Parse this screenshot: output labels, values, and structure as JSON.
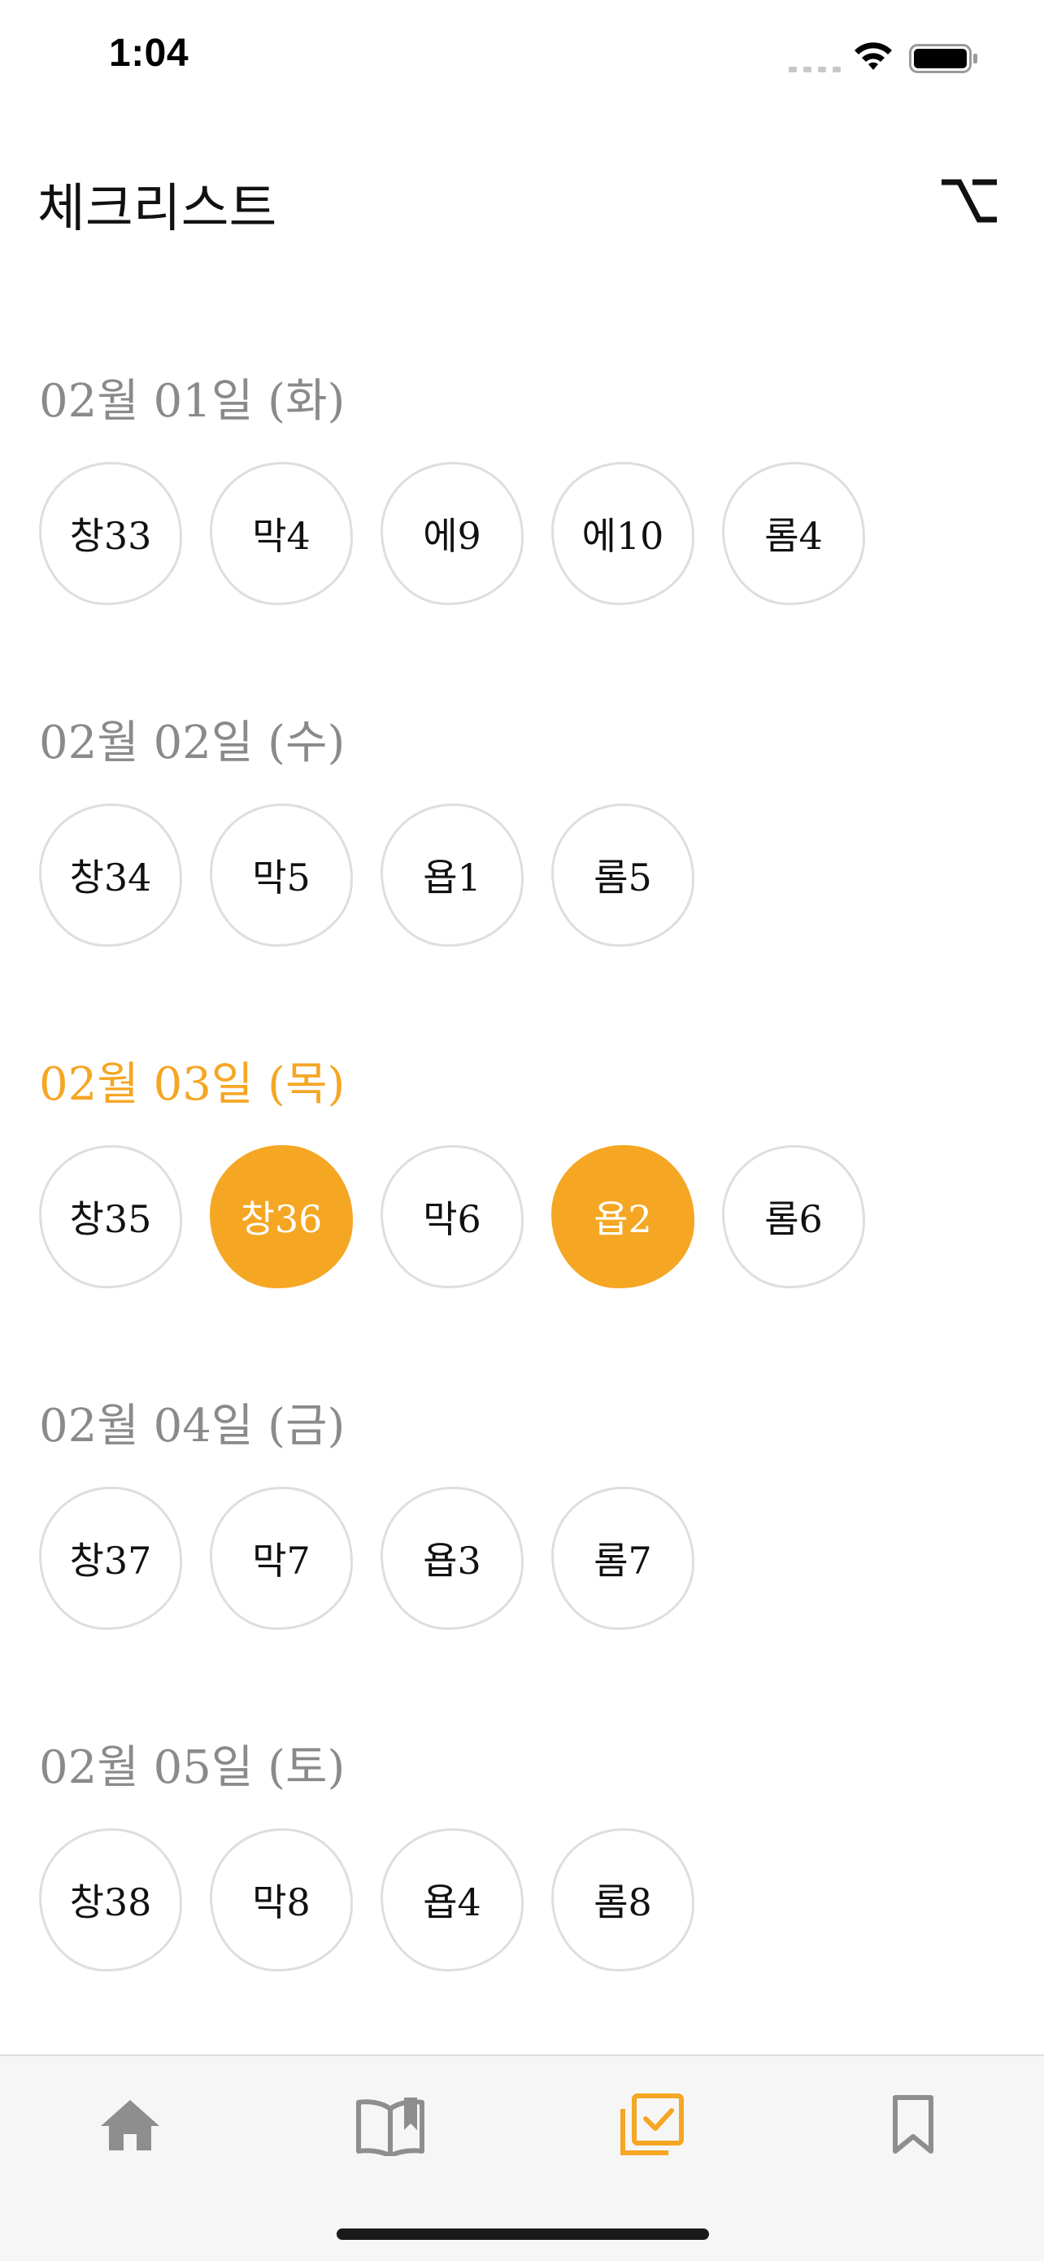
{
  "status_bar": {
    "time": "1:04"
  },
  "header": {
    "title": "체크리스트",
    "filter_icon": "option-key-icon"
  },
  "sections": [
    {
      "date": "02월 01일 (화)",
      "today": false,
      "chips": [
        {
          "label": "창33",
          "done": false
        },
        {
          "label": "막4",
          "done": false
        },
        {
          "label": "에9",
          "done": false
        },
        {
          "label": "에10",
          "done": false
        },
        {
          "label": "롬4",
          "done": false
        }
      ]
    },
    {
      "date": "02월 02일 (수)",
      "today": false,
      "chips": [
        {
          "label": "창34",
          "done": false
        },
        {
          "label": "막5",
          "done": false
        },
        {
          "label": "욥1",
          "done": false
        },
        {
          "label": "롬5",
          "done": false
        }
      ]
    },
    {
      "date": "02월 03일 (목)",
      "today": true,
      "chips": [
        {
          "label": "창35",
          "done": false
        },
        {
          "label": "창36",
          "done": true
        },
        {
          "label": "막6",
          "done": false
        },
        {
          "label": "욥2",
          "done": true
        },
        {
          "label": "롬6",
          "done": false
        }
      ]
    },
    {
      "date": "02월 04일 (금)",
      "today": false,
      "chips": [
        {
          "label": "창37",
          "done": false
        },
        {
          "label": "막7",
          "done": false
        },
        {
          "label": "욥3",
          "done": false
        },
        {
          "label": "롬7",
          "done": false
        }
      ]
    },
    {
      "date": "02월 05일 (토)",
      "today": false,
      "chips": [
        {
          "label": "창38",
          "done": false
        },
        {
          "label": "막8",
          "done": false
        },
        {
          "label": "욥4",
          "done": false
        },
        {
          "label": "롬8",
          "done": false
        }
      ]
    }
  ],
  "tab_bar": {
    "tabs": [
      {
        "icon": "home-icon",
        "active": false
      },
      {
        "icon": "book-open-icon",
        "active": false
      },
      {
        "icon": "checklist-icon",
        "active": true
      },
      {
        "icon": "bookmark-icon",
        "active": false
      }
    ]
  },
  "colors": {
    "accent": "#f5a623",
    "inactive_icon": "#8e8e8e",
    "date_gray": "#8a8a8a",
    "chip_border": "#dedede"
  }
}
